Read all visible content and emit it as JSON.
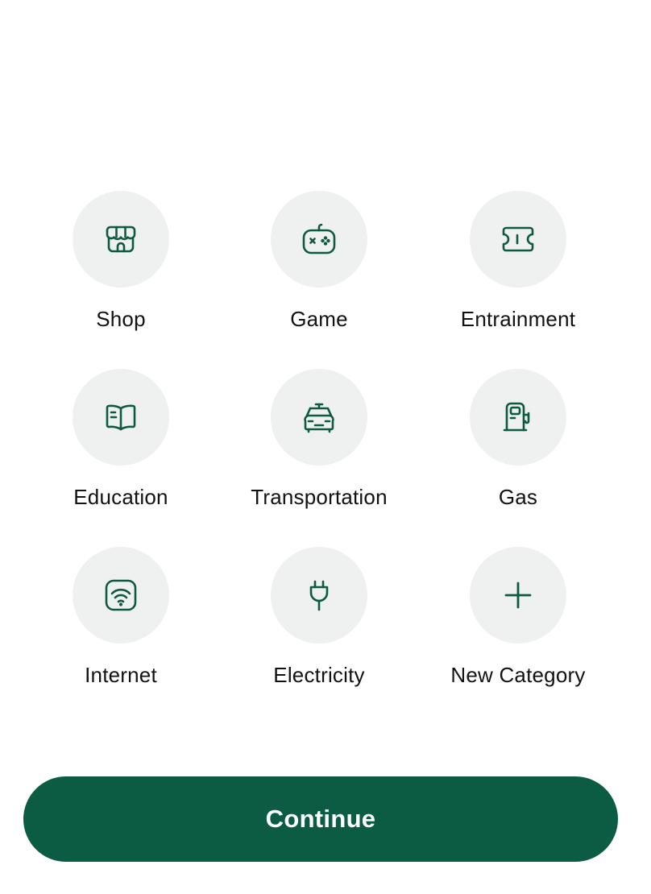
{
  "categories": [
    {
      "label": "Shop",
      "icon": "shop-icon"
    },
    {
      "label": "Game",
      "icon": "gamepad-icon"
    },
    {
      "label": "Entrainment",
      "icon": "ticket-icon"
    },
    {
      "label": "Education",
      "icon": "book-icon"
    },
    {
      "label": "Transportation",
      "icon": "car-icon"
    },
    {
      "label": "Gas",
      "icon": "gas-pump-icon"
    },
    {
      "label": "Internet",
      "icon": "wifi-icon"
    },
    {
      "label": "Electricity",
      "icon": "plug-icon"
    },
    {
      "label": "New Category",
      "icon": "plus-icon"
    }
  ],
  "continue_label": "Continue",
  "colors": {
    "accent": "#0b5c42",
    "icon": "#0d5a3f",
    "circle_bg": "#eef1f0"
  }
}
